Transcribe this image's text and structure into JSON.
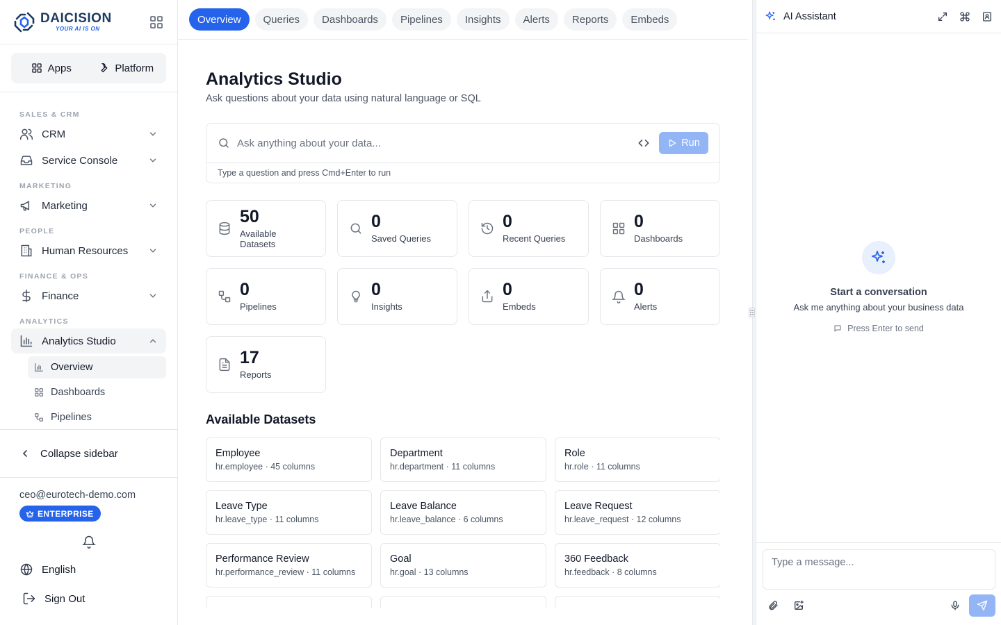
{
  "brand": {
    "name": "DAICISION",
    "tagline": "YOUR AI IS ON"
  },
  "switcher": {
    "apps": "Apps",
    "platform": "Platform"
  },
  "sidebar": {
    "sections": [
      {
        "label": "SALES & CRM",
        "items": [
          {
            "label": "CRM",
            "icon": "users-icon"
          },
          {
            "label": "Service Console",
            "icon": "inbox-icon"
          }
        ]
      },
      {
        "label": "MARKETING",
        "items": [
          {
            "label": "Marketing",
            "icon": "megaphone-icon"
          }
        ]
      },
      {
        "label": "PEOPLE",
        "items": [
          {
            "label": "Human Resources",
            "icon": "building-icon"
          }
        ]
      },
      {
        "label": "FINANCE & OPS",
        "items": [
          {
            "label": "Finance",
            "icon": "dollar-icon"
          }
        ]
      },
      {
        "label": "ANALYTICS",
        "items": [
          {
            "label": "Analytics Studio",
            "icon": "bar-chart-icon",
            "expanded": true
          }
        ]
      }
    ],
    "subitems": [
      {
        "label": "Overview",
        "icon": "bar-chart-icon",
        "active": true
      },
      {
        "label": "Dashboards",
        "icon": "grid-icon"
      },
      {
        "label": "Pipelines",
        "icon": "workflow-icon"
      }
    ],
    "collapse": "Collapse sidebar",
    "user_email": "ceo@eurotech-demo.com",
    "plan_badge": "ENTERPRISE",
    "language": "English",
    "sign_out": "Sign Out"
  },
  "tabs": [
    "Overview",
    "Queries",
    "Dashboards",
    "Pipelines",
    "Insights",
    "Alerts",
    "Reports",
    "Embeds"
  ],
  "active_tab": "Overview",
  "page": {
    "title": "Analytics Studio",
    "subtitle": "Ask questions about your data using natural language or SQL"
  },
  "query": {
    "placeholder": "Ask anything about your data...",
    "run_label": "Run",
    "hint": "Type a question and press Cmd+Enter to run"
  },
  "stats": [
    {
      "value": "50",
      "label": "Available Datasets",
      "icon": "database-icon"
    },
    {
      "value": "0",
      "label": "Saved Queries",
      "icon": "search-icon"
    },
    {
      "value": "0",
      "label": "Recent Queries",
      "icon": "history-icon"
    },
    {
      "value": "0",
      "label": "Dashboards",
      "icon": "grid-icon"
    },
    {
      "value": "0",
      "label": "Pipelines",
      "icon": "workflow-icon"
    },
    {
      "value": "0",
      "label": "Insights",
      "icon": "lightbulb-icon"
    },
    {
      "value": "0",
      "label": "Embeds",
      "icon": "share-icon"
    },
    {
      "value": "0",
      "label": "Alerts",
      "icon": "bell-icon"
    },
    {
      "value": "17",
      "label": "Reports",
      "icon": "file-text-icon"
    }
  ],
  "datasets_title": "Available Datasets",
  "datasets": [
    {
      "name": "Employee",
      "meta": "hr.employee · 45 columns"
    },
    {
      "name": "Department",
      "meta": "hr.department · 11 columns"
    },
    {
      "name": "Role",
      "meta": "hr.role · 11 columns"
    },
    {
      "name": "Leave Type",
      "meta": "hr.leave_type · 11 columns"
    },
    {
      "name": "Leave Balance",
      "meta": "hr.leave_balance · 6 columns"
    },
    {
      "name": "Leave Request",
      "meta": "hr.leave_request · 12 columns"
    },
    {
      "name": "Performance Review",
      "meta": "hr.performance_review · 11 columns"
    },
    {
      "name": "Goal",
      "meta": "hr.goal · 13 columns"
    },
    {
      "name": "360 Feedback",
      "meta": "hr.feedback · 8 columns"
    }
  ],
  "assistant": {
    "title": "AI Assistant",
    "empty_title": "Start a conversation",
    "empty_subtitle": "Ask me anything about your business data",
    "empty_hint": "Press Enter to send",
    "input_placeholder": "Type a message..."
  },
  "colors": {
    "accent": "#2563eb",
    "accent_disabled": "#93b4f5",
    "border": "#e5e7eb"
  }
}
